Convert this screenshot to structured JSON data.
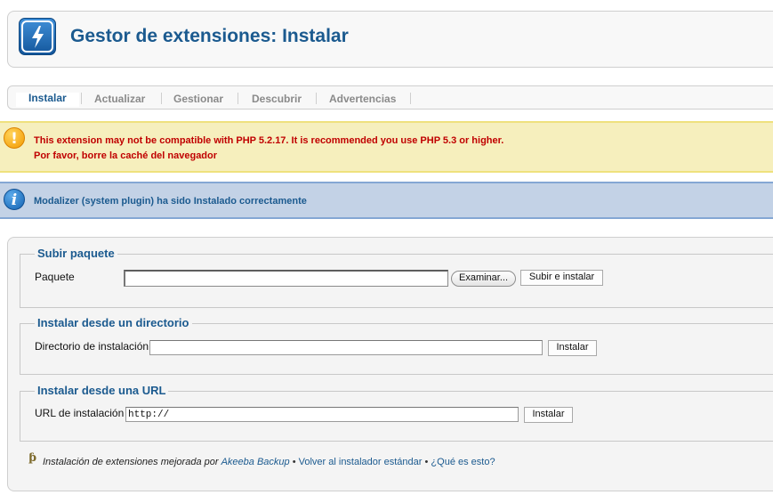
{
  "header": {
    "title": "Gestor de extensiones: Instalar",
    "icon": "lightning-icon",
    "icon_color": "#1b6fbf"
  },
  "tabs": [
    {
      "label": "Instalar",
      "active": true
    },
    {
      "label": "Actualizar",
      "active": false
    },
    {
      "label": "Gestionar",
      "active": false
    },
    {
      "label": "Descubrir",
      "active": false
    },
    {
      "label": "Advertencias",
      "active": false
    }
  ],
  "messages": {
    "warning": {
      "icon": "exclamation-icon",
      "lines": [
        "This extension may not be compatible with PHP 5.2.17. It is recommended you use PHP 5.3 or higher.",
        "Por favor, borre la caché del navegador"
      ],
      "color": "#c00000"
    },
    "info": {
      "icon": "info-icon",
      "text": "Modalizer (system plugin) ha sido Instalado correctamente",
      "color": "#1b5a8f"
    }
  },
  "upload": {
    "legend": "Subir paquete",
    "label": "Paquete",
    "value": "",
    "browse_label": "Examinar...",
    "submit_label": "Subir e instalar"
  },
  "directory": {
    "legend": "Instalar desde un directorio",
    "label": "Directorio de instalación",
    "value": "",
    "submit_label": "Instalar"
  },
  "url": {
    "legend": "Instalar desde una URL",
    "label": "URL de instalación",
    "value": "http://",
    "submit_label": "Instalar"
  },
  "footer": {
    "icon": "plugin-icon",
    "text": "Instalación de extensiones mejorada por",
    "akeeba_link": "Akeeba Backup",
    "separator": "•",
    "revert_link": "Volver al instalador estándar",
    "help_link": "¿Qué es esto?"
  },
  "colors": {
    "accent": "#1b5a8f",
    "warning_bg": "#f6efbd",
    "info_bg": "#c3d2e6"
  }
}
